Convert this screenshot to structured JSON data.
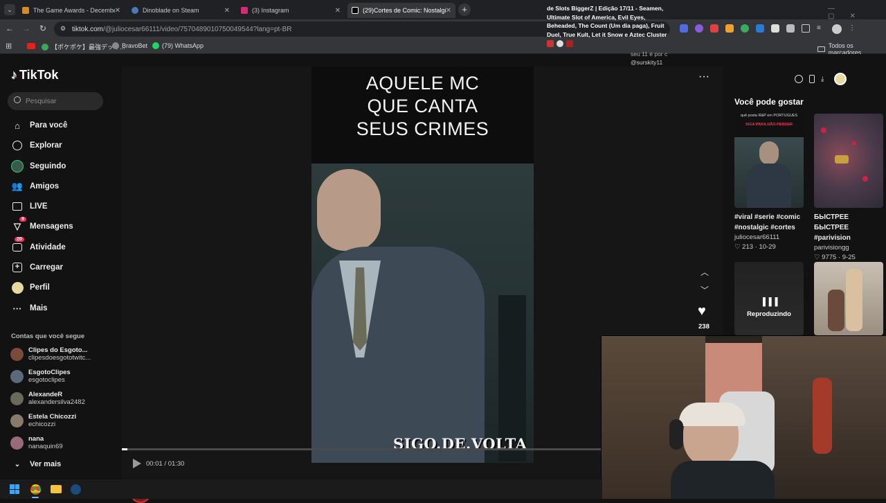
{
  "browser": {
    "tabs": [
      {
        "title": "The Game Awards - December",
        "icon_color": "#d48a2a"
      },
      {
        "title": "Dinoblade on Steam",
        "icon_color": "#4a7ab3"
      },
      {
        "title": "(3) Instagram",
        "icon_color": "#d62976"
      },
      {
        "title": "(29)Cortes de Comic: Nostalgia",
        "icon_color": "#ffffff"
      }
    ],
    "url": "tiktok.com",
    "url_path": "/@juliocesar66111/video/7570489010750049544?lang=pt-BR",
    "bookmarks": [
      {
        "label": "【ポケポケ】最強デッキ...",
        "icon_color": "#3ea55a"
      },
      {
        "label": "BravoBet",
        "icon_color": "#888888"
      },
      {
        "label": "(79) WhatsApp",
        "icon_color": "#25d366"
      }
    ],
    "all_bookmarks": "Todos os marcadores"
  },
  "notification": {
    "lines": [
      "de Slots BiggerZ | Edição 17/11 - Seamen,",
      "Ultimate Slot of America, Evil Eyes,",
      "Beheaded, The Count (Um dia paga), Fruit",
      "Duel, True Kult, Let it Snow e Aztec Cluster"
    ],
    "meta": "seu 11 é por c",
    "handle": "@surskity11"
  },
  "tiktok": {
    "logo": "TikTok",
    "search_placeholder": "Pesquisar",
    "nav": [
      {
        "label": "Para você",
        "icon": "home-icon"
      },
      {
        "label": "Explorar",
        "icon": "compass-icon"
      },
      {
        "label": "Seguindo",
        "icon": "following-icon"
      },
      {
        "label": "Amigos",
        "icon": "friends-icon"
      },
      {
        "label": "LIVE",
        "icon": "live-icon"
      },
      {
        "label": "Mensagens",
        "icon": "messages-icon",
        "badge": "9"
      },
      {
        "label": "Atividade",
        "icon": "activity-icon",
        "badge": "20"
      },
      {
        "label": "Carregar",
        "icon": "upload-icon"
      },
      {
        "label": "Perfil",
        "icon": "profile-icon"
      },
      {
        "label": "Mais",
        "icon": "more-icon"
      }
    ],
    "following_title": "Contas que você segue",
    "accounts": [
      {
        "name": "Clipes do Esgoto...",
        "handle": "clipesdoesgototwitc...",
        "color": "#7a4a3a"
      },
      {
        "name": "EsgotoClipes",
        "handle": "esgotoclipes",
        "color": "#5a6a7a"
      },
      {
        "name": "AlexandeR",
        "handle": "alexandersilva2482",
        "color": "#6a6a5a"
      },
      {
        "name": "Estela Chicozzi",
        "handle": "echicozzi",
        "color": "#8a7a6a"
      },
      {
        "name": "nana",
        "handle": "nanaquin69",
        "color": "#9a6a7a"
      }
    ],
    "see_more": "Ver mais",
    "video": {
      "title_lines": [
        "AQUELE MC",
        "QUE CANTA",
        "SEUS CRIMES"
      ],
      "watermark": "SIGO.DE.VOLTA",
      "time": "00:01 / 01:30",
      "likes": "238",
      "author": "juliocesar66111"
    },
    "recommendations": {
      "title": "Você pode gostar",
      "items": [
        {
          "caption": "#viral #serie #comic #nostalgic #cortes",
          "user": "juliocesar66111",
          "likes": "213",
          "date": "10-29",
          "overlay_top": "quê posta R&P em PORTUGUÊS",
          "overlay_red": "SIGA PARA NÃO PERDER"
        },
        {
          "caption": "БЫСТРЕЕ БЫСТРЕЕ #parivision",
          "user": "parivisiongg",
          "likes": "9775",
          "date": "9-25"
        },
        {
          "overlay_center": "Reproduzindo"
        },
        {}
      ]
    }
  }
}
